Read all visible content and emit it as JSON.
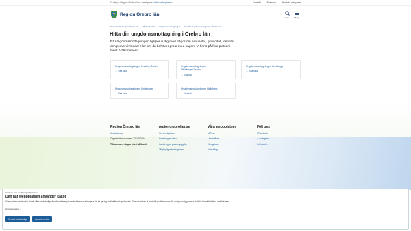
{
  "topbar": {
    "info_text": "Du är på Region Örebro läns webbplats.",
    "info_link": "Hitta webbplatser",
    "links": [
      "Kontakt",
      "Eservice",
      "Kontakt och press"
    ]
  },
  "header": {
    "logo_text": "Region Örebro län",
    "search_label": "Sök",
    "menu_label": "Meny"
  },
  "breadcrumb": [
    "Startsida för Region Örebro län",
    "Vård och hälsa",
    "Ungdomsmottagningar",
    "Hitta din ungdomsmottagning i Örebro län"
  ],
  "main": {
    "title": "Hitta din ungdomsmottagning i Örebro län",
    "intro": "På Ungdomsmottagningen hjälper vi dig med frågor om sexualitet, graviditet, identitet och preventivmedel eller om du behöver prata med någon. Vi finns på fem platser i länet. Välkommen!",
    "cards": [
      {
        "title": "Ungdomsmottagningen Knuffen Örebro",
        "link": "Visa sida"
      },
      {
        "title": "Ungdomsmottagningen\nNätaltorget Örebro",
        "link": "Visa sida"
      },
      {
        "title": "Ungdomsmottagningen Karlskoga",
        "link": "Visa sida"
      },
      {
        "title": "Ungdomsmottagningen Lindesberg",
        "link": "Visa sida"
      },
      {
        "title": "Ungdomsmottagningen Hallsberg",
        "link": "Visa sida"
      }
    ]
  },
  "footer": {
    "col1": {
      "heading": "Region Örebro län",
      "items": [
        "Kontakta oss",
        "Organisationsnummer: 2321000164",
        "Tillsammans skapar vi ett hållbar liv"
      ]
    },
    "col2": {
      "heading": "regionorebrolan.se",
      "items": [
        "Om webbplatsen",
        "Hantering av kakor",
        "Hantering av personuppgifter",
        "Tillgänglighetsredogörelse"
      ]
    },
    "col3": {
      "heading": "Våra webbplatser",
      "items": [
        "1177.se",
        "Länstrafiken",
        "Vårdguiden",
        "Utveckling"
      ]
    },
    "col4": {
      "heading": "Följ oss",
      "items": [
        "Facebook",
        "Instagram",
        "LinkedIn"
      ]
    }
  },
  "cookie": {
    "small": "Hantera dina inställningar för kakor",
    "title": "Den här webbplatsen använder kakor",
    "text": "Vi använder webbkakor för att våra nödvändiga funktionaliteter på webbplatsen ska fungera för att ge dig en förbättrad upplevelse. Dessutom kan vi med ditt godkännande för analysverktyg samla statistik för att förbättra webbplatsen.",
    "settings": "Anpassa kakor",
    "btn_necessary": "Endast nödvändiga",
    "btn_accept": "Acceptera alla"
  },
  "colors": {
    "brand": "#1c5c99",
    "logo": "#1c3f6e",
    "button": "#1c5c99"
  },
  "icons": [
    "logo-icon",
    "search-icon",
    "menu-icon",
    "arrow-right-icon",
    "facebook-icon",
    "instagram-icon",
    "linkedin-icon",
    "chevron-down-icon"
  ]
}
